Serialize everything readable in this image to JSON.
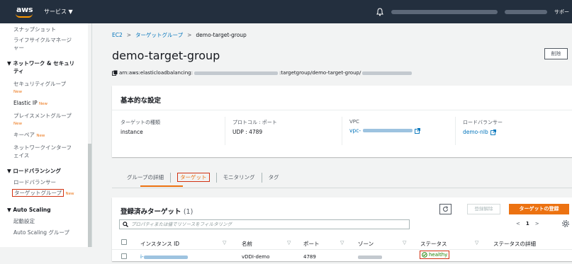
{
  "topbar": {
    "logo_text": "aws",
    "services_label": "サービス ▼",
    "support_label": "サポー"
  },
  "sidebar": {
    "items": [
      {
        "label": "スナップショット"
      },
      {
        "label": "ライフサイクルマネージ"
      },
      {
        "label": "ャー"
      },
      {
        "label": "セキュリティグループ"
      },
      {
        "label": "Elastic IP"
      },
      {
        "label": "プレイスメントグループ"
      },
      {
        "label": "キーペア"
      },
      {
        "label": "ネットワークインターフ"
      },
      {
        "label": "ェイス"
      },
      {
        "label": "ロードバランサー"
      },
      {
        "label": "ターゲットグループ"
      },
      {
        "label": "起動設定"
      },
      {
        "label": "Auto Scaling グループ"
      }
    ],
    "sections": {
      "network_line1": "▼ ネットワーク & セキュリ",
      "network_line2": "ティ",
      "lb": "▼ ロードバランシング",
      "as": "▼ Auto Scaling"
    },
    "new_badge": "New"
  },
  "breadcrumb": {
    "ec2": "EC2",
    "tg": "ターゲットグループ",
    "current": "demo-target-group",
    "sep": ">"
  },
  "page": {
    "title": "demo-target-group",
    "delete_label": "削除",
    "arn_prefix": "arn:aws:elasticloadbalancing:",
    "arn_mid": ":targetgroup/demo-target-group/"
  },
  "details": {
    "heading": "基本的な設定",
    "target_type_label": "ターゲットの種類",
    "target_type_value": "instance",
    "protocol_label": "プロトコル : ポート",
    "protocol_value": "UDP : 4789",
    "vpc_label": "VPC",
    "vpc_value": "vpc-",
    "lb_label": "ロードバランサー",
    "lb_value": "demo-nlb"
  },
  "tabs": [
    {
      "label": "グループの詳細"
    },
    {
      "label": "ターゲット"
    },
    {
      "label": "モニタリング"
    },
    {
      "label": "タグ"
    }
  ],
  "targets": {
    "heading": "登録済みターゲット",
    "count": "(1)",
    "deregister_label": "登録解除",
    "register_label": "ターゲットの登録",
    "filter_placeholder": "プロパティまたは値でリソースをフィルタリング",
    "page_current": "1",
    "columns": [
      "インスタンス ID",
      "名前",
      "ポート",
      "ゾーン",
      "ステータス",
      "ステータスの詳細"
    ],
    "rows": [
      {
        "instance_id": "i-",
        "name": "vDDI-demo",
        "port": "4789",
        "zone": "",
        "status": "healthy",
        "status_detail": ""
      }
    ]
  },
  "colors": {
    "accent": "#ec7211",
    "link": "#0073bb",
    "healthy": "#1d8102",
    "annotation": "#d13212"
  }
}
